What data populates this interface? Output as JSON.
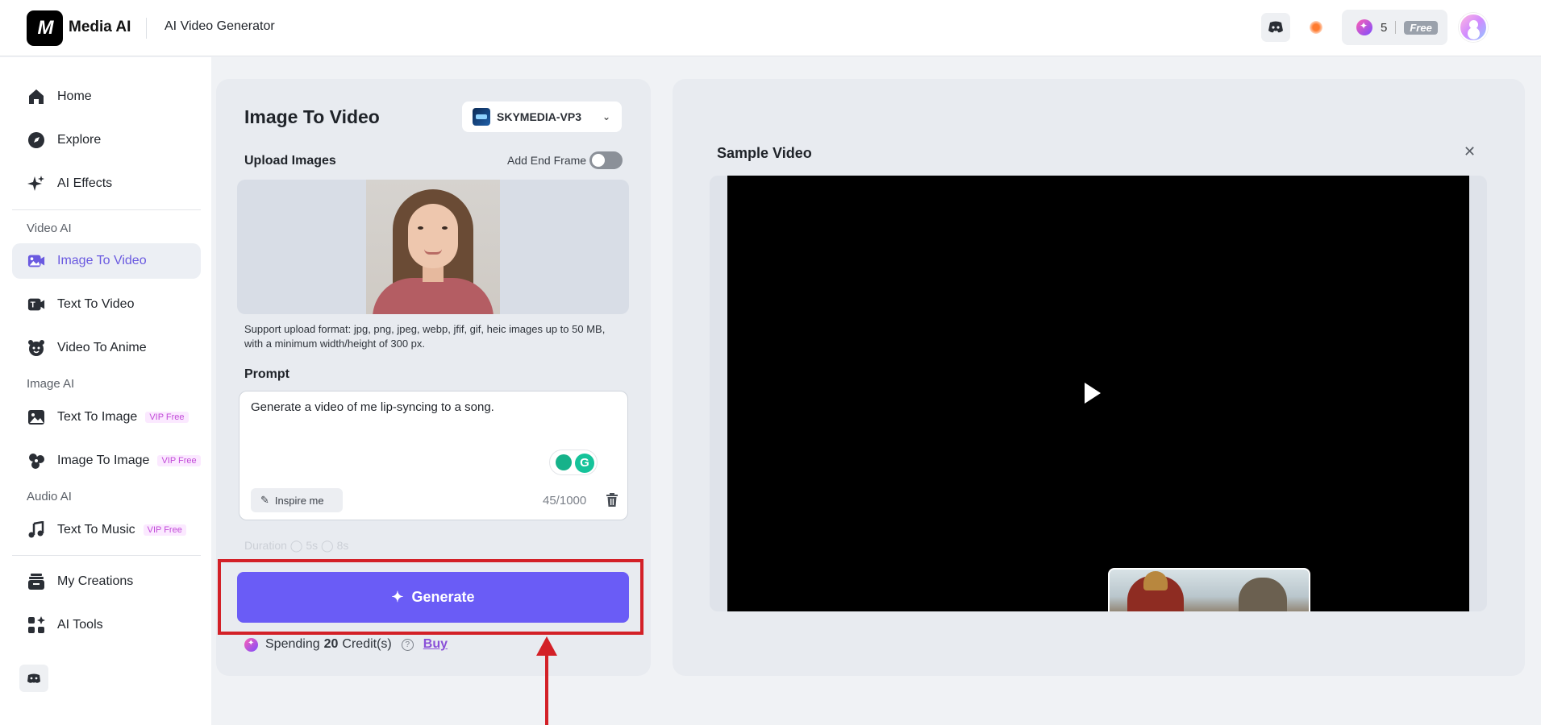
{
  "header": {
    "logo_text": "M",
    "brand": "Media AI",
    "title": "AI Video Generator",
    "credits": "5",
    "plan_badge": "Free",
    "icons": [
      "discord-icon",
      "notification-dot",
      "credit-gem-icon",
      "avatar"
    ]
  },
  "sidebar": {
    "items_top": [
      {
        "label": "Home",
        "icon": "home-icon"
      },
      {
        "label": "Explore",
        "icon": "compass-icon"
      },
      {
        "label": "AI Effects",
        "icon": "sparkles-icon"
      }
    ],
    "video_section": "Video AI",
    "video_items": [
      {
        "label": "Image To Video",
        "icon": "image-video-icon",
        "active": true
      },
      {
        "label": "Text To Video",
        "icon": "text-video-icon"
      },
      {
        "label": "Video To Anime",
        "icon": "anime-icon"
      }
    ],
    "image_section": "Image AI",
    "image_items": [
      {
        "label": "Text To Image",
        "badge": "VIP Free",
        "icon": "text-image-icon"
      },
      {
        "label": "Image To Image",
        "badge": "VIP Free",
        "icon": "image-image-icon"
      }
    ],
    "audio_section": "Audio AI",
    "audio_items": [
      {
        "label": "Text To Music",
        "badge": "VIP Free",
        "icon": "music-icon"
      }
    ],
    "items_bottom": [
      {
        "label": "My Creations",
        "icon": "stack-icon"
      },
      {
        "label": "AI Tools",
        "icon": "tools-icon"
      }
    ]
  },
  "left_panel": {
    "title": "Image To Video",
    "model": "SKYMEDIA-VP3",
    "upload_label": "Upload Images",
    "end_frame_label": "Add End Frame",
    "end_frame_enabled": false,
    "support_text": "Support upload format: jpg, png, jpeg, webp, jfif, gif, heic images up to 50 MB, with a minimum width/height of 300 px.",
    "prompt_label": "Prompt",
    "prompt_value": "Generate a video of me lip-syncing to a song.",
    "inspire_label": "Inspire me",
    "char_count": "45/1000",
    "faded_row": "Duration    ◯ 5s    ◯ 8s",
    "generate_label": "Generate",
    "spend_prefix": "Spending",
    "spend_amount": "20",
    "spend_suffix": "Credit(s)",
    "buy_label": "Buy"
  },
  "right_panel": {
    "title": "Sample Video",
    "close_icon": "close-icon",
    "play_icon": "play-icon"
  },
  "colors": {
    "accent": "#6a5cf6",
    "annotation": "#d32027",
    "active_nav_text": "#6a5ae0"
  }
}
